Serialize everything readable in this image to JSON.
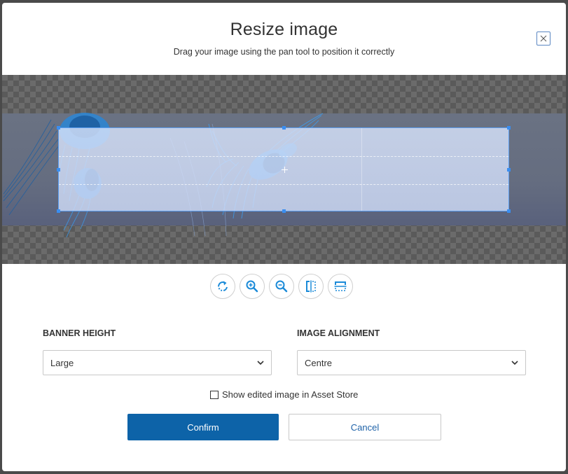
{
  "header": {
    "title": "Resize image",
    "subtitle": "Drag your image using the pan tool to position it correctly",
    "close_icon": "close-icon"
  },
  "editor": {
    "image_subject": "jellyfish",
    "background": "transparency-checkerboard",
    "accent_color": "#3a8ef0"
  },
  "toolbar": {
    "tools": [
      {
        "name": "rotate",
        "icon": "rotate-icon"
      },
      {
        "name": "zoom-in",
        "icon": "zoom-in-icon"
      },
      {
        "name": "zoom-out",
        "icon": "zoom-out-icon"
      },
      {
        "name": "flip-horizontal",
        "icon": "flip-horizontal-icon"
      },
      {
        "name": "flip-vertical",
        "icon": "flip-vertical-icon"
      }
    ],
    "icon_color": "#1a8ad8"
  },
  "form": {
    "banner_height": {
      "label": "BANNER HEIGHT",
      "value": "Large"
    },
    "image_alignment": {
      "label": "IMAGE ALIGNMENT",
      "value": "Centre"
    },
    "show_in_asset_store": {
      "label": "Show edited image in Asset Store",
      "checked": false
    }
  },
  "actions": {
    "confirm_label": "Confirm",
    "cancel_label": "Cancel",
    "primary_color": "#0d63a8"
  }
}
